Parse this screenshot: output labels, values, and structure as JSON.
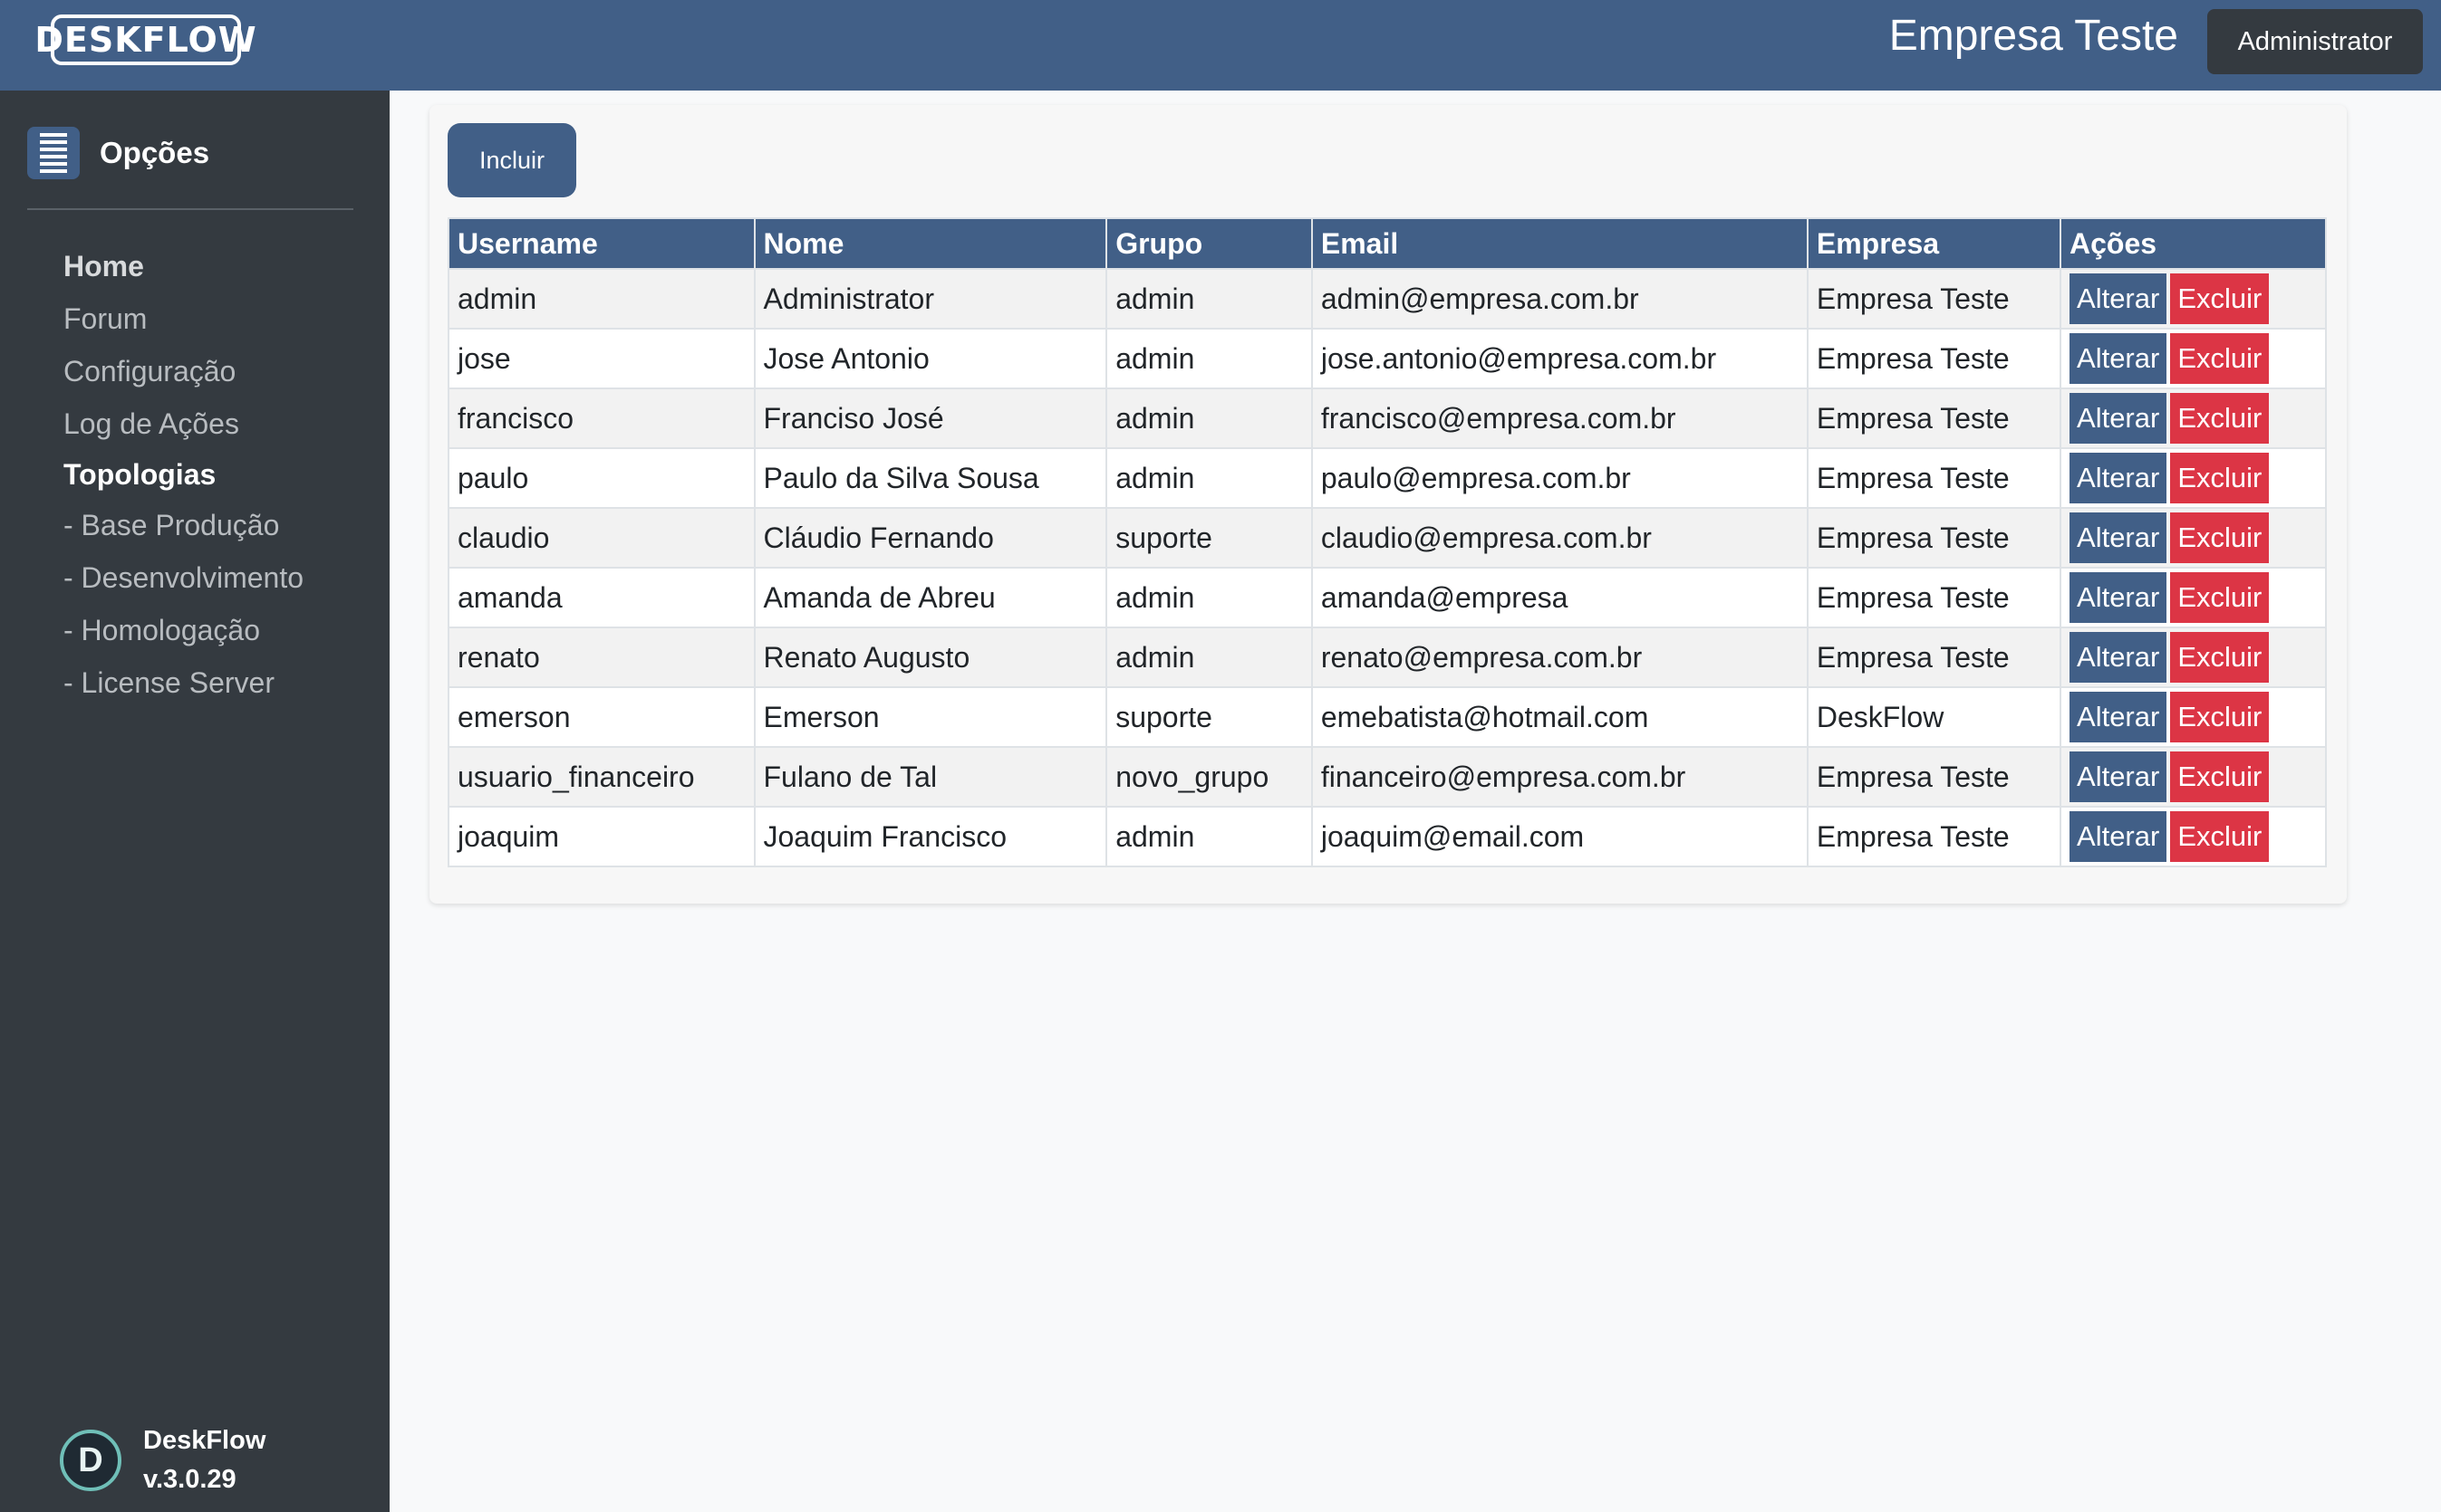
{
  "header": {
    "logo_text": "DESKFLOW",
    "company": "Empresa Teste",
    "user_button": "Administrator"
  },
  "sidebar": {
    "title": "Opções",
    "items": [
      {
        "label": "Home",
        "style": "bold"
      },
      {
        "label": "Forum",
        "style": "normal"
      },
      {
        "label": "Configuração",
        "style": "normal"
      },
      {
        "label": "Log de Ações",
        "style": "normal"
      },
      {
        "label": "Topologias",
        "style": "section"
      },
      {
        "label": "- Base Produção",
        "style": "sub"
      },
      {
        "label": "- Desenvolvimento",
        "style": "sub"
      },
      {
        "label": "- Homologação",
        "style": "sub"
      },
      {
        "label": "- License Server",
        "style": "sub"
      }
    ],
    "footer": {
      "icon_letter": "D",
      "app_name": "DeskFlow",
      "version": "v.3.0.29"
    }
  },
  "main": {
    "include_button": "Incluir",
    "table": {
      "headers": [
        "Username",
        "Nome",
        "Grupo",
        "Email",
        "Empresa",
        "Ações"
      ],
      "edit_label": "Alterar",
      "delete_label": "Excluir",
      "rows": [
        [
          "admin",
          "Administrator",
          "admin",
          "admin@empresa.com.br",
          "Empresa Teste"
        ],
        [
          "jose",
          "Jose Antonio",
          "admin",
          "jose.antonio@empresa.com.br",
          "Empresa Teste"
        ],
        [
          "francisco",
          "Franciso José",
          "admin",
          "francisco@empresa.com.br",
          "Empresa Teste"
        ],
        [
          "paulo",
          "Paulo da Silva Sousa",
          "admin",
          "paulo@empresa.com.br",
          "Empresa Teste"
        ],
        [
          "claudio",
          "Cláudio Fernando",
          "suporte",
          "claudio@empresa.com.br",
          "Empresa Teste"
        ],
        [
          "amanda",
          "Amanda de Abreu",
          "admin",
          "amanda@empresa",
          "Empresa Teste"
        ],
        [
          "renato",
          "Renato Augusto",
          "admin",
          "renato@empresa.com.br",
          "Empresa Teste"
        ],
        [
          "emerson",
          "Emerson",
          "suporte",
          "emebatista@hotmail.com",
          "DeskFlow"
        ],
        [
          "usuario_financeiro",
          "Fulano de Tal",
          "novo_grupo",
          "financeiro@empresa.com.br",
          "Empresa Teste"
        ],
        [
          "joaquim",
          "Joaquim Francisco",
          "admin",
          "joaquim@email.com",
          "Empresa Teste"
        ]
      ]
    }
  },
  "colors": {
    "primary": "#415f87",
    "sidebar_bg": "#343a40",
    "danger": "#dc3545",
    "page_bg": "#f8f9fa"
  }
}
